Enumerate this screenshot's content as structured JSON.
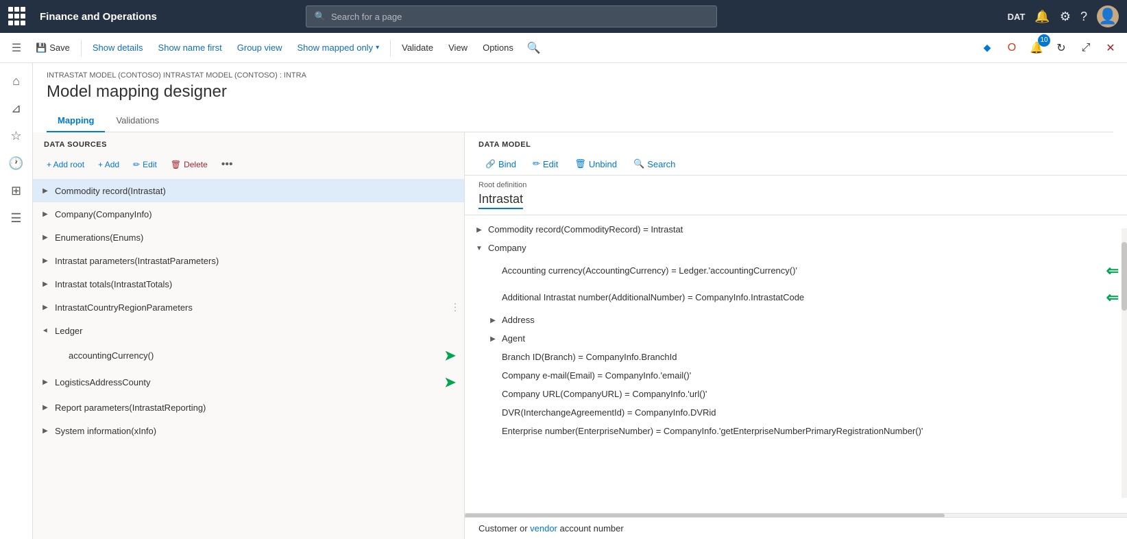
{
  "app": {
    "title": "Finance and Operations",
    "search_placeholder": "Search for a page",
    "env_label": "DAT"
  },
  "toolbar": {
    "save_label": "Save",
    "show_details_label": "Show details",
    "show_name_first_label": "Show name first",
    "group_view_label": "Group view",
    "show_mapped_only_label": "Show mapped only",
    "validate_label": "Validate",
    "view_label": "View",
    "options_label": "Options"
  },
  "page": {
    "breadcrumb": "INTRASTAT MODEL (CONTOSO) INTRASTAT MODEL (CONTOSO) : INTRA",
    "title": "Model mapping designer",
    "tabs": [
      "Mapping",
      "Validations"
    ]
  },
  "data_sources": {
    "header": "DATA SOURCES",
    "add_root": "+ Add root",
    "add": "+ Add",
    "edit": "Edit",
    "delete": "Delete",
    "items": [
      {
        "label": "Commodity record(Intrastat)",
        "level": 0,
        "expanded": false,
        "selected": true,
        "has_children": true
      },
      {
        "label": "Company(CompanyInfo)",
        "level": 0,
        "expanded": false,
        "selected": false,
        "has_children": true
      },
      {
        "label": "Enumerations(Enums)",
        "level": 0,
        "expanded": false,
        "selected": false,
        "has_children": true
      },
      {
        "label": "Intrastat parameters(IntrastatParameters)",
        "level": 0,
        "expanded": false,
        "selected": false,
        "has_children": true
      },
      {
        "label": "Intrastat totals(IntrastatTotals)",
        "level": 0,
        "expanded": false,
        "selected": false,
        "has_children": true
      },
      {
        "label": "IntrastatCountryRegionParameters",
        "level": 0,
        "expanded": false,
        "selected": false,
        "has_children": true
      },
      {
        "label": "Ledger",
        "level": 0,
        "expanded": true,
        "selected": false,
        "has_children": true
      },
      {
        "label": "accountingCurrency()",
        "level": 1,
        "expanded": false,
        "selected": false,
        "has_children": false,
        "has_arrow": true
      },
      {
        "label": "LogisticsAddressCounty",
        "level": 0,
        "expanded": false,
        "selected": false,
        "has_children": true,
        "has_arrow": true
      },
      {
        "label": "Report parameters(IntrastatReporting)",
        "level": 0,
        "expanded": false,
        "selected": false,
        "has_children": true
      },
      {
        "label": "System information(xInfo)",
        "level": 0,
        "expanded": false,
        "selected": false,
        "has_children": true
      }
    ]
  },
  "data_model": {
    "header": "DATA MODEL",
    "bind_label": "Bind",
    "edit_label": "Edit",
    "unbind_label": "Unbind",
    "search_label": "Search",
    "root_def_label": "Root definition",
    "root_value": "Intrastat",
    "items": [
      {
        "label": "Commodity record(CommodityRecord) = Intrastat",
        "level": 0,
        "expanded": false,
        "has_children": true
      },
      {
        "label": "Company",
        "level": 0,
        "expanded": true,
        "has_children": true
      },
      {
        "label": "Accounting currency(AccountingCurrency) = Ledger.'accountingCurrency()'",
        "level": 1,
        "has_children": false,
        "has_right_arrow": true
      },
      {
        "label": "Additional Intrastat number(AdditionalNumber) = CompanyInfo.IntrastatCode",
        "level": 1,
        "has_children": false,
        "has_right_arrow": true
      },
      {
        "label": "Address",
        "level": 1,
        "expanded": false,
        "has_children": true
      },
      {
        "label": "Agent",
        "level": 1,
        "expanded": false,
        "has_children": true
      },
      {
        "label": "Branch ID(Branch) = CompanyInfo.BranchId",
        "level": 1,
        "has_children": false
      },
      {
        "label": "Company e-mail(Email) = CompanyInfo.'email()'",
        "level": 1,
        "has_children": false
      },
      {
        "label": "Company URL(CompanyURL) = CompanyInfo.'url()'",
        "level": 1,
        "has_children": false
      },
      {
        "label": "DVR(InterchangeAgreementId) = CompanyInfo.DVRid",
        "level": 1,
        "has_children": false
      },
      {
        "label": "Enterprise number(EnterpriseNumber) = CompanyInfo.'getEnterpriseNumberPrimaryRegistrationNumber()'",
        "level": 1,
        "has_children": false
      }
    ],
    "footer": "Customer or vendor account number"
  }
}
